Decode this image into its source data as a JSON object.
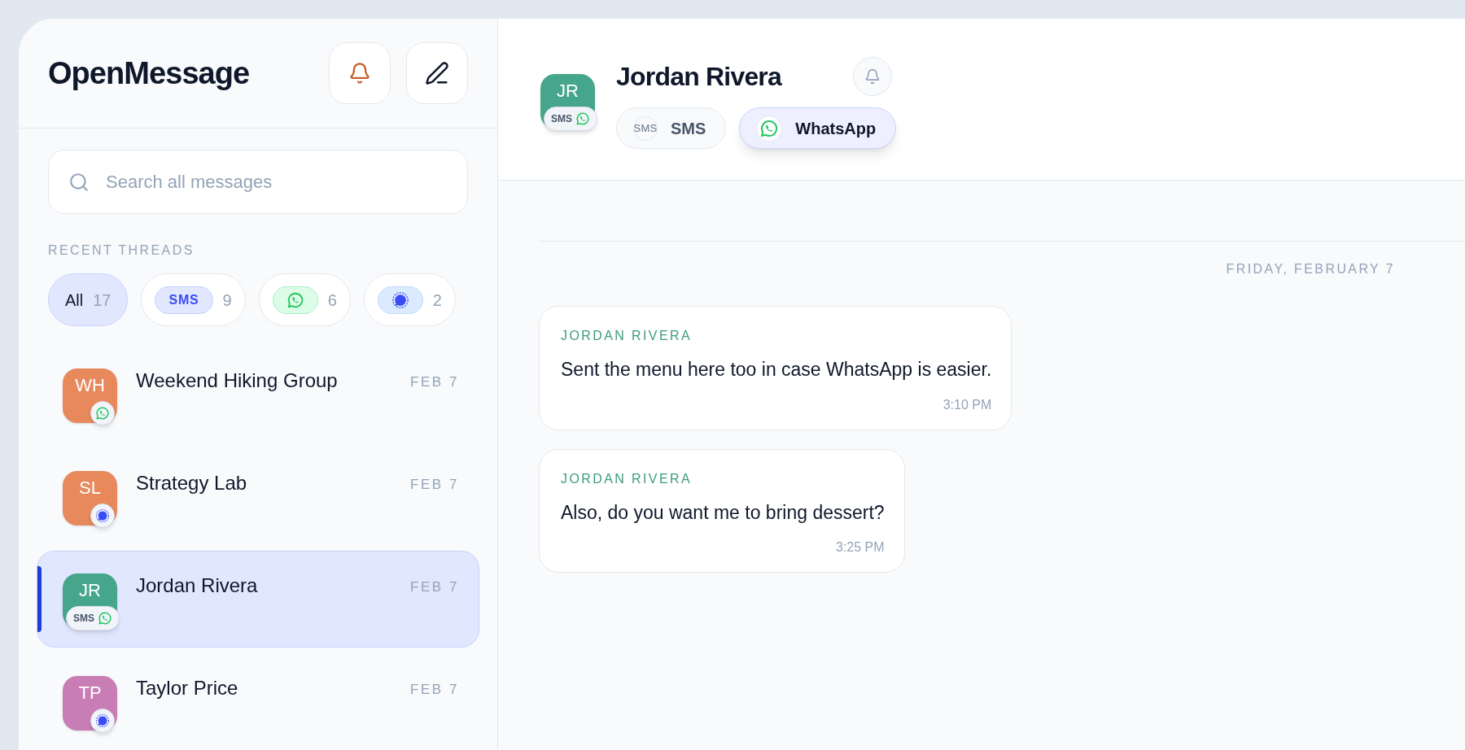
{
  "app": {
    "title": "OpenMessage"
  },
  "search": {
    "placeholder": "Search all messages"
  },
  "section_label": "RECENT THREADS",
  "filters": [
    {
      "kind": "all",
      "label": "All",
      "count": "17",
      "selected": true
    },
    {
      "kind": "sms",
      "label": "SMS",
      "count": "9",
      "selected": false
    },
    {
      "kind": "whatsapp",
      "count": "6",
      "selected": false
    },
    {
      "kind": "signal",
      "count": "2",
      "selected": false
    }
  ],
  "threads": [
    {
      "initials": "WH",
      "name": "Weekend Hiking Group",
      "date": "FEB 7",
      "color": "#e8895c",
      "selected": false,
      "badges": [
        {
          "kind": "whatsapp"
        }
      ]
    },
    {
      "initials": "SL",
      "name": "Strategy Lab",
      "date": "FEB 7",
      "color": "#e8895c",
      "selected": false,
      "badges": [
        {
          "kind": "signal"
        }
      ]
    },
    {
      "initials": "JR",
      "name": "Jordan Rivera",
      "date": "FEB 7",
      "color": "#45a68c",
      "selected": true,
      "badges": [
        {
          "kind": "sms",
          "label": "SMS"
        },
        {
          "kind": "whatsapp"
        }
      ]
    },
    {
      "initials": "TP",
      "name": "Taylor Price",
      "date": "FEB 7",
      "color": "#c97db5",
      "selected": false,
      "badges": [
        {
          "kind": "signal"
        }
      ]
    }
  ],
  "conversation": {
    "initials": "JR",
    "color": "#45a68c",
    "name": "Jordan Rivera",
    "badges": [
      {
        "kind": "sms",
        "label": "SMS"
      },
      {
        "kind": "whatsapp"
      }
    ],
    "channels": [
      {
        "kind": "sms",
        "icon_text": "SMS",
        "label": "SMS",
        "selected": false
      },
      {
        "kind": "whatsapp",
        "label": "WhatsApp",
        "selected": true
      }
    ]
  },
  "date_divider": "FRIDAY, FEBRUARY 7",
  "messages": [
    {
      "sender": "JORDAN RIVERA",
      "text": "Sent the menu here too in case WhatsApp is easier.",
      "time": "3:10 PM"
    },
    {
      "sender": "JORDAN RIVERA",
      "text": "Also, do you want me to bring dessert?",
      "time": "3:25 PM"
    }
  ]
}
